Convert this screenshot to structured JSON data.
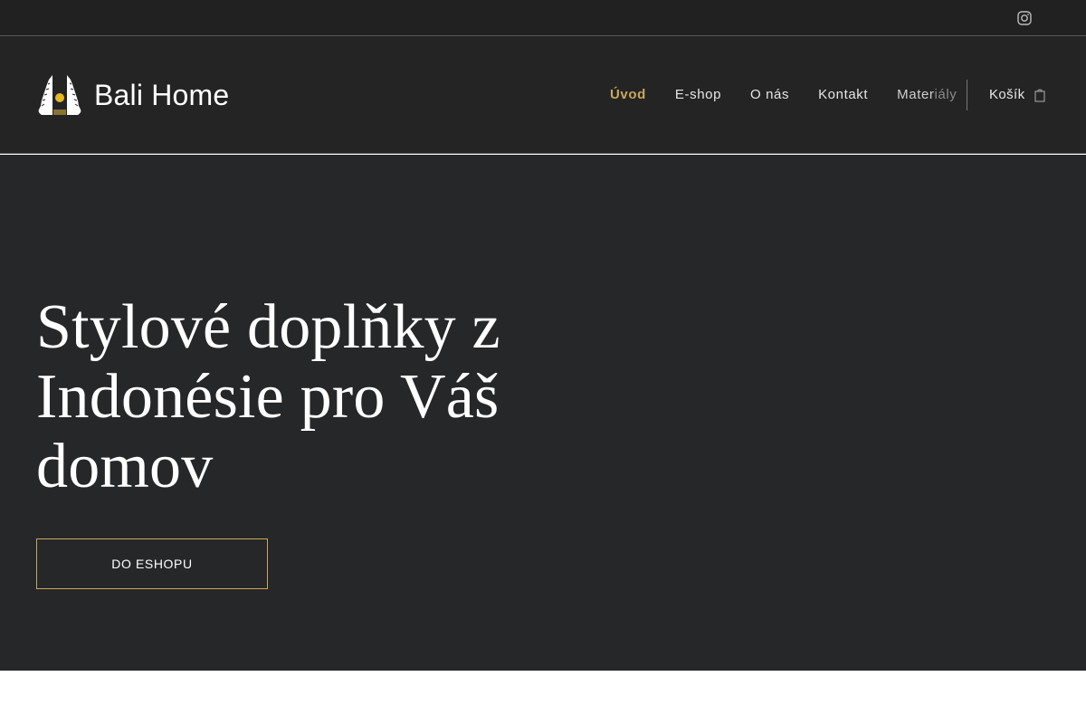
{
  "topbar": {
    "social_icon": "instagram-icon"
  },
  "header": {
    "brand_name": "Bali Home",
    "logo_icon": "bali-gate-logo",
    "nav": [
      {
        "label": "Úvod",
        "active": true
      },
      {
        "label": "E-shop"
      },
      {
        "label": "O nás"
      },
      {
        "label": "Kontakt"
      },
      {
        "label_part1": "Mater",
        "label_part2": "iály"
      }
    ],
    "cart_label": "Košík",
    "cart_icon": "shopping-bag-icon"
  },
  "hero": {
    "headline": "Stylové doplňky z Indonésie pro Váš domov",
    "cta_label": "DO ESHOPU"
  },
  "colors": {
    "topbar_bg": "#212121",
    "header_bg": "#242424",
    "hero_bg": "#262729",
    "accent_gold": "#c9a85a"
  }
}
